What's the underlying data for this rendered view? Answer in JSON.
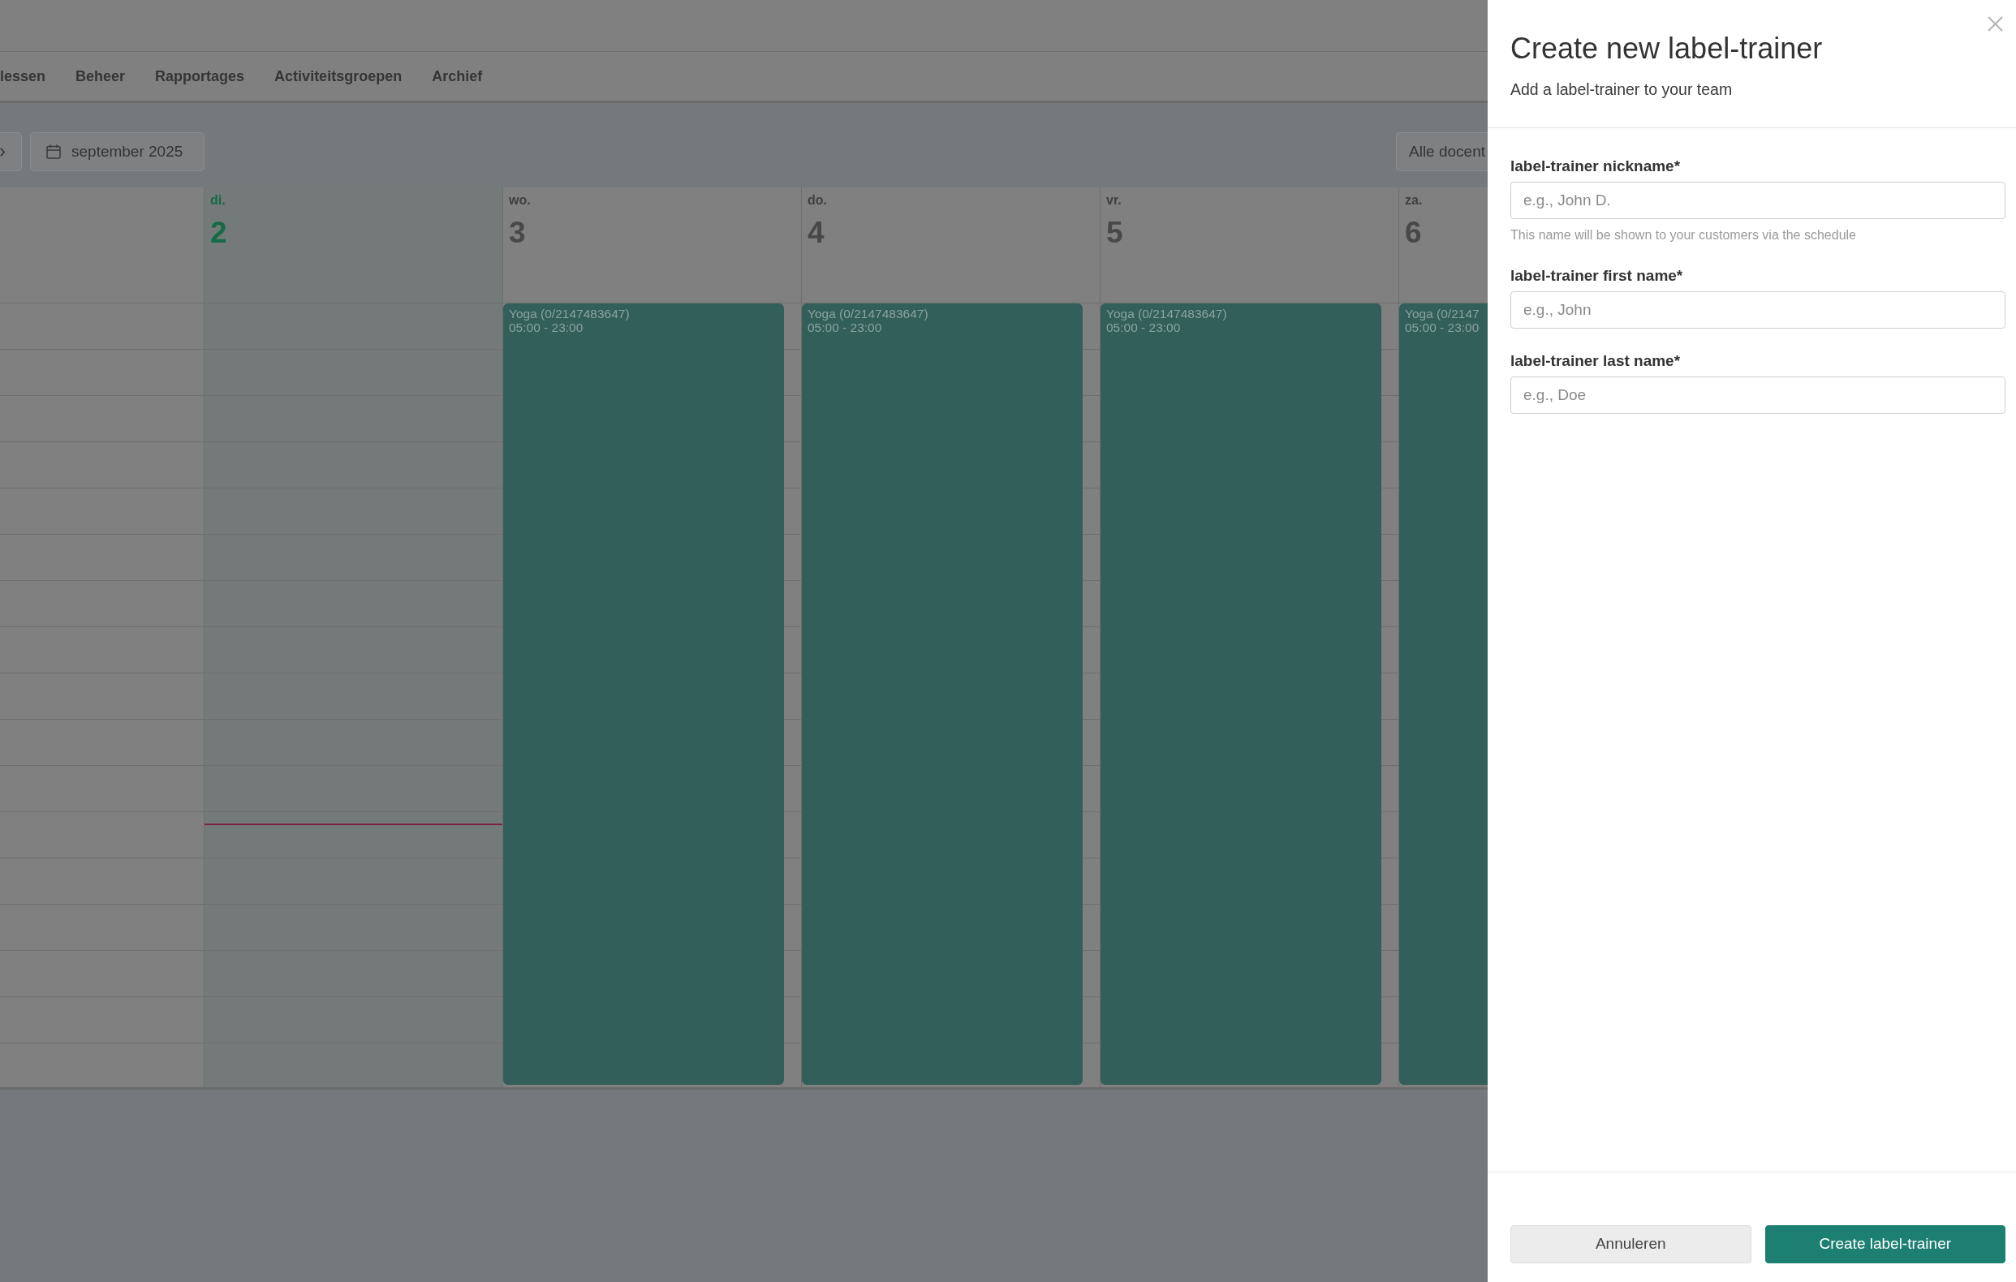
{
  "nav": {
    "items": [
      {
        "label": "lessen"
      },
      {
        "label": "Beheer"
      },
      {
        "label": "Rapportages"
      },
      {
        "label": "Activiteitsgroepen"
      },
      {
        "label": "Archief"
      }
    ]
  },
  "toolbar": {
    "month_button": {
      "label": "september 2025"
    },
    "filter_button": {
      "label": "Alle docent"
    }
  },
  "calendar": {
    "days": [
      {
        "weekday": "di.",
        "day": "2",
        "today": true
      },
      {
        "weekday": "wo.",
        "day": "3",
        "today": false,
        "events": [
          {
            "title": "Yoga (0/2147483647)",
            "time": "05:00 - 23:00"
          }
        ]
      },
      {
        "weekday": "do.",
        "day": "4",
        "today": false,
        "events": [
          {
            "title": "Yoga (0/2147483647)",
            "time": "05:00 - 23:00"
          }
        ]
      },
      {
        "weekday": "vr.",
        "day": "5",
        "today": false,
        "events": [
          {
            "title": "Yoga (0/2147483647)",
            "time": "05:00 - 23:00"
          }
        ]
      },
      {
        "weekday": "za.",
        "day": "6",
        "today": false,
        "events": [
          {
            "title": "Yoga (0/2147",
            "time": "05:00 - 23:00"
          }
        ]
      }
    ]
  },
  "drawer": {
    "title": "Create new label-trainer",
    "subtitle": "Add a label-trainer to your team",
    "fields": [
      {
        "label": "label-trainer nickname*",
        "placeholder": "e.g., John D.",
        "help": "This name will be shown to your customers via the schedule"
      },
      {
        "label": "label-trainer first name*",
        "placeholder": "e.g., John"
      },
      {
        "label": "label-trainer last name*",
        "placeholder": "e.g., Doe"
      }
    ],
    "buttons": [
      {
        "label": "Annuleren",
        "kind": "secondary"
      },
      {
        "label": "Create label-trainer",
        "kind": "primary"
      }
    ]
  }
}
